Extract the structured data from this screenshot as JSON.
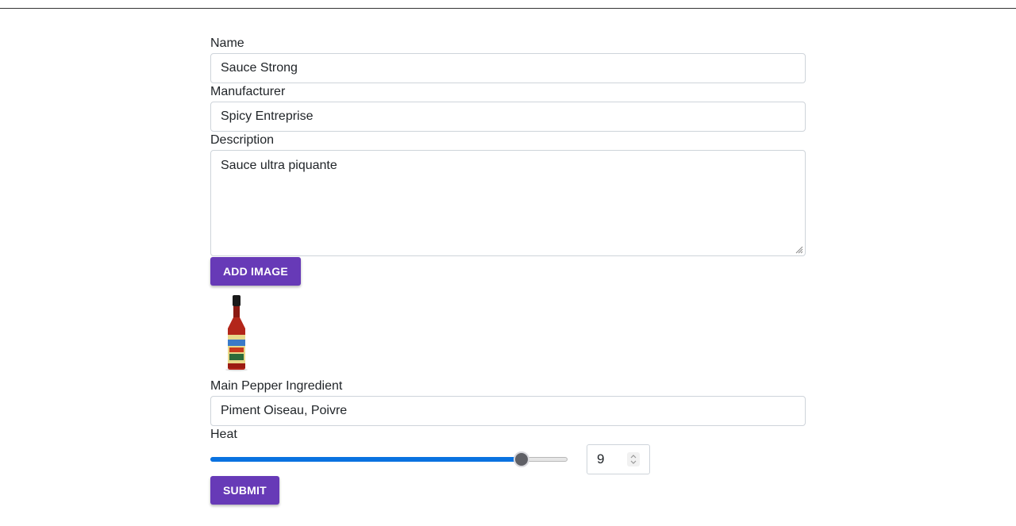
{
  "form": {
    "name_label": "Name",
    "name_value": "Sauce Strong",
    "manufacturer_label": "Manufacturer",
    "manufacturer_value": "Spicy Entreprise",
    "description_label": "Description",
    "description_value": "Sauce ultra piquante",
    "add_image_label": "ADD IMAGE",
    "pepper_label": "Main Pepper Ingredient",
    "pepper_value": "Piment Oiseau, Poivre",
    "heat_label": "Heat",
    "heat_value": "9",
    "heat_fraction": 0.87,
    "submit_label": "SUBMIT"
  },
  "colors": {
    "button": "#673ab7",
    "slider_fill": "#0a72e0"
  },
  "icons": {
    "product_image": "hot-sauce-bottle-icon"
  }
}
